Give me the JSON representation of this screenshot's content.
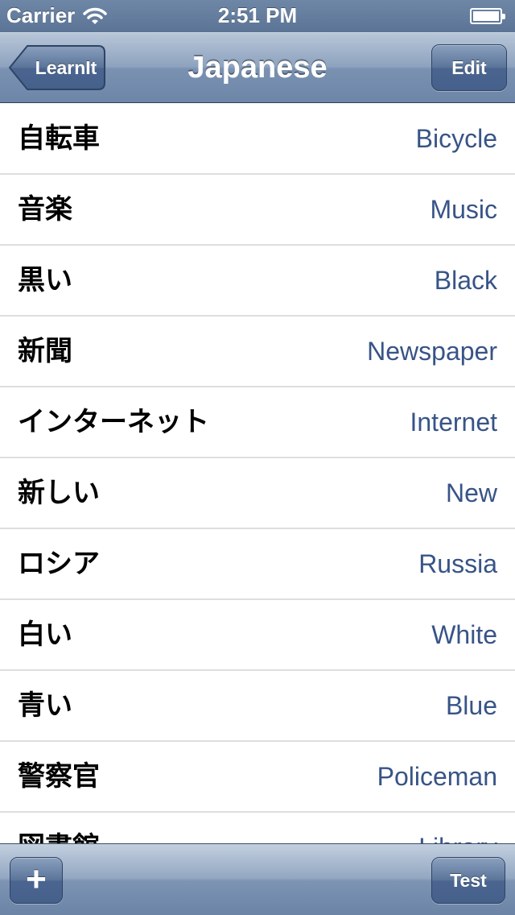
{
  "status_bar": {
    "carrier": "Carrier",
    "time": "2:51 PM",
    "icons": [
      "wifi-icon",
      "battery-icon"
    ]
  },
  "nav": {
    "back_label": "LearnIt",
    "title": "Japanese",
    "edit_label": "Edit"
  },
  "words": [
    {
      "jp": "自転車",
      "en": "Bicycle"
    },
    {
      "jp": "音楽",
      "en": "Music"
    },
    {
      "jp": "黒い",
      "en": "Black"
    },
    {
      "jp": "新聞",
      "en": "Newspaper"
    },
    {
      "jp": "インターネット",
      "en": "Internet"
    },
    {
      "jp": "新しい",
      "en": "New"
    },
    {
      "jp": "ロシア",
      "en": "Russia"
    },
    {
      "jp": "白い",
      "en": "White"
    },
    {
      "jp": "青い",
      "en": "Blue"
    },
    {
      "jp": "警察官",
      "en": "Policeman"
    },
    {
      "jp": "図書館",
      "en": "Library"
    }
  ],
  "toolbar": {
    "add_icon": "plus-icon",
    "add_symbol": "+",
    "test_label": "Test"
  },
  "colors": {
    "bar_blue": "#6d86a8",
    "detail_text": "#385487"
  }
}
